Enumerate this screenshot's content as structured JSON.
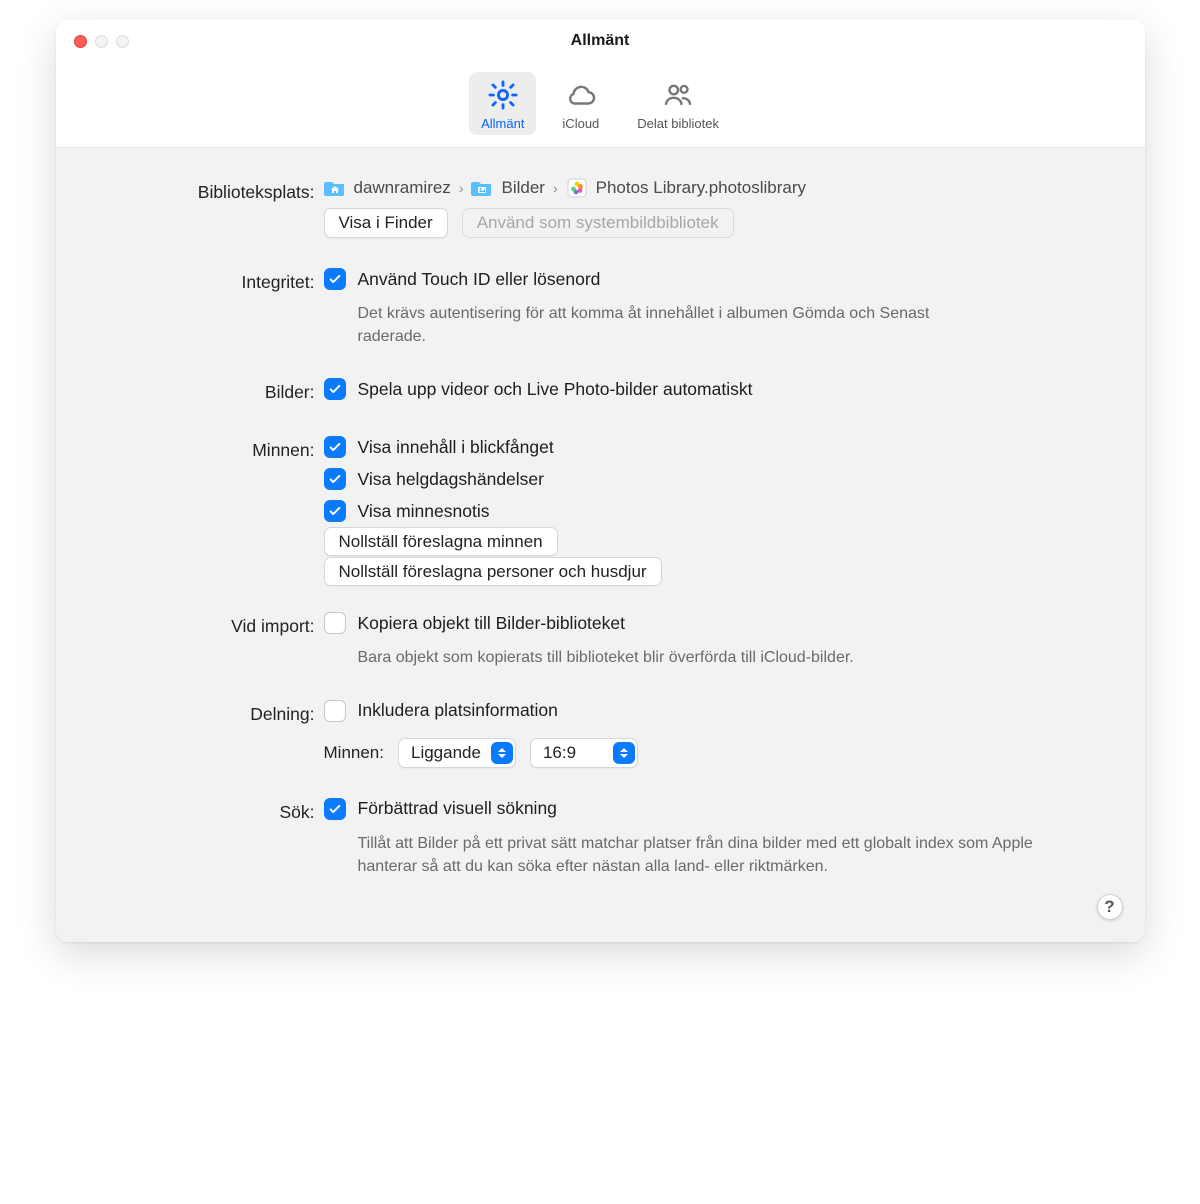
{
  "window": {
    "title": "Allmänt"
  },
  "tabs": {
    "general": "Allmänt",
    "icloud": "iCloud",
    "shared": "Delat bibliotek"
  },
  "labels": {
    "library": "Biblioteksplats:",
    "integrity": "Integritet:",
    "photos": "Bilder:",
    "memories": "Minnen:",
    "onimport": "Vid import:",
    "sharing": "Delning:",
    "search": "Sök:",
    "memories_sel": "Minnen:"
  },
  "breadcrumb": {
    "user": "dawnramirez",
    "pictures": "Bilder",
    "library": "Photos Library.photoslibrary"
  },
  "buttons": {
    "show_in_finder": "Visa i Finder",
    "use_system": "Använd som systembildbibliotek",
    "reset_memories": "Nollställ föreslagna minnen",
    "reset_people": "Nollställ föreslagna personer och husdjur"
  },
  "options": {
    "touchid": "Använd Touch ID eller lösenord",
    "touchid_desc": "Det krävs autentisering för att komma åt innehållet i albumen Gömda och Senast raderade.",
    "autoplay": "Spela upp videor och Live Photo-bilder automatiskt",
    "featured": "Visa innehåll i blickfånget",
    "holiday": "Visa helgdagshändelser",
    "notif": "Visa minnesnotis",
    "copy_import": "Kopiera objekt till Bilder-biblioteket",
    "copy_import_desc": "Bara objekt som kopierats till biblioteket blir överförda till iCloud-bilder.",
    "include_location": "Inkludera platsinformation",
    "enhanced_search": "Förbättrad visuell sökning",
    "enhanced_search_desc": "Tillåt att Bilder på ett privat sätt matchar platser från dina bilder med ett globalt index som Apple hanterar så att du kan söka efter nästan alla land- eller riktmärken."
  },
  "selects": {
    "orientation": "Liggande",
    "ratio": "16:9"
  },
  "help": "?"
}
